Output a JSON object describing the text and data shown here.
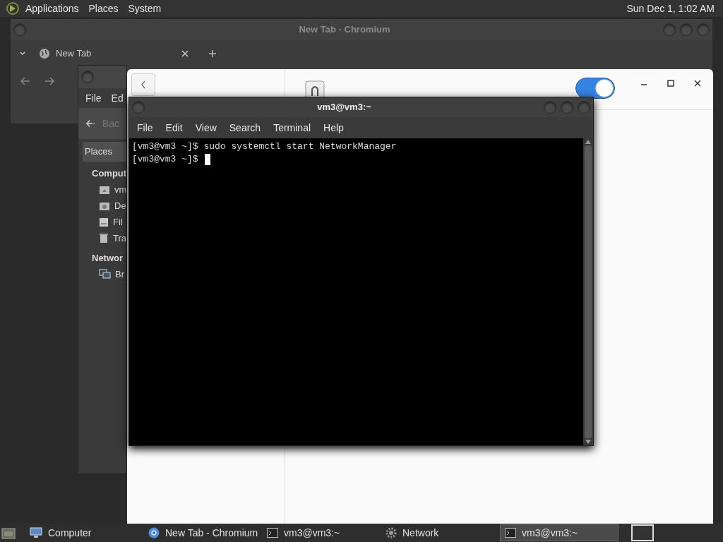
{
  "top_panel": {
    "menus": [
      "Applications",
      "Places",
      "System"
    ],
    "clock": "Sun Dec 1, 1:02 AM"
  },
  "browser": {
    "title": "New Tab - Chromium",
    "tabs": [
      {
        "label": "New Tab",
        "selected": true
      }
    ]
  },
  "file_manager": {
    "menu": [
      "File",
      "Ed"
    ],
    "back": "Bac",
    "sidebar_dropdown": "Places",
    "sections": [
      {
        "heading": "Comput",
        "items": [
          {
            "label": "vm",
            "kind": "home"
          },
          {
            "label": "De",
            "kind": "desktop"
          },
          {
            "label": "Fil",
            "kind": "drive"
          },
          {
            "label": "Tra",
            "kind": "trash"
          }
        ]
      },
      {
        "heading": "Networ",
        "items": [
          {
            "label": "Br",
            "kind": "network"
          }
        ]
      }
    ]
  },
  "settings": {
    "toggle_on": true
  },
  "terminal": {
    "title": "vm3@vm3:~",
    "menu": [
      "File",
      "Edit",
      "View",
      "Search",
      "Terminal",
      "Help"
    ],
    "lines": [
      "[vm3@vm3 ~]$ sudo systemctl start NetworkManager",
      "[vm3@vm3 ~]$"
    ]
  },
  "taskbar": {
    "items": [
      {
        "label": "Computer",
        "kind": "computer",
        "selected": false
      },
      {
        "label": "New Tab - Chromium",
        "kind": "browser",
        "selected": false
      },
      {
        "label": "vm3@vm3:~",
        "kind": "terminal",
        "selected": false
      },
      {
        "label": "Network",
        "kind": "network",
        "selected": false
      },
      {
        "label": "vm3@vm3:~",
        "kind": "terminal",
        "selected": true
      }
    ]
  }
}
